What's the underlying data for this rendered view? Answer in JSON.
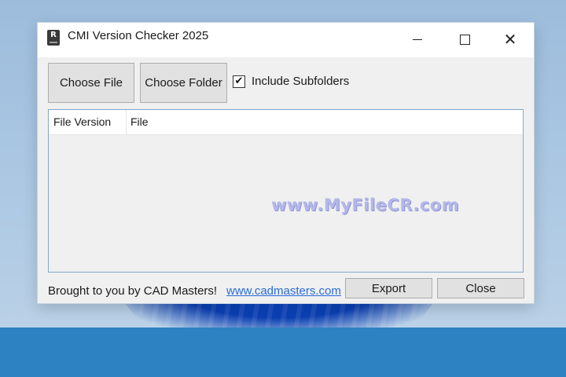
{
  "window": {
    "title": "CMI Version Checker 2025",
    "icon": "app-icon",
    "controls": {
      "minimize": "minimize-icon",
      "maximize": "maximize-icon",
      "close": "✕"
    }
  },
  "toolbar": {
    "choose_file_label": "Choose File",
    "choose_folder_label": "Choose Folder",
    "include_subfolders_label": "Include Subfolders",
    "include_subfolders_checked": true,
    "check_glyph": "✔"
  },
  "list": {
    "columns": [
      "File Version",
      "File"
    ],
    "rows": []
  },
  "watermark": "www.MyFileCR.com",
  "footer": {
    "credit_text": "Brought to you by CAD Masters!",
    "link_text": "www.cadmasters.com",
    "export_label": "Export",
    "close_label": "Close"
  },
  "colors": {
    "taskbar": "#2d82c2",
    "link": "#2a6cd6",
    "list_border": "#82a9cc"
  }
}
